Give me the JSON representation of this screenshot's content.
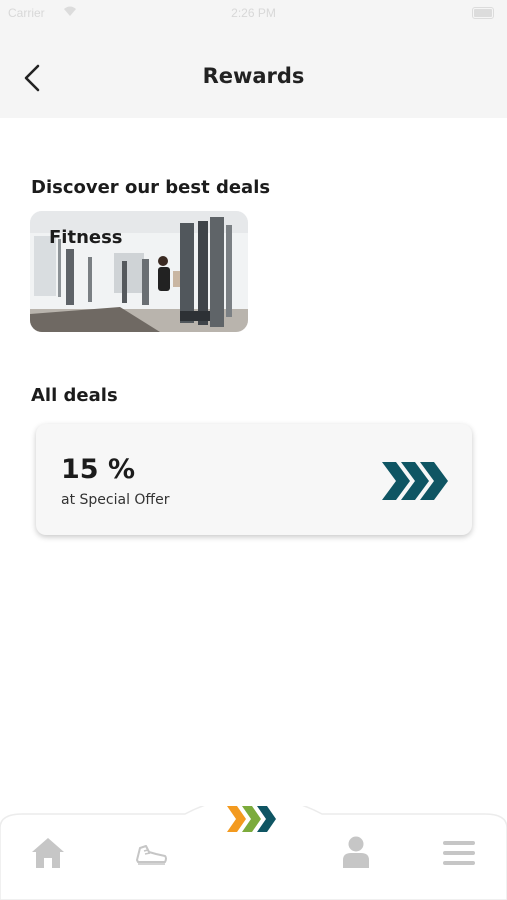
{
  "status_bar": {
    "carrier": "Carrier",
    "time": "2:26 PM"
  },
  "header": {
    "title": "Rewards",
    "back_icon": "chevron-left-icon"
  },
  "discover": {
    "title": "Discover our best deals",
    "tiles": [
      {
        "label": "Fitness",
        "image": "gym-photo"
      }
    ]
  },
  "all_deals": {
    "title": "All deals",
    "offers": [
      {
        "value": "15 %",
        "description": "at Special Offer",
        "icon": "triple-chevron-icon"
      }
    ]
  },
  "tab_bar": {
    "items": [
      {
        "name": "home",
        "icon": "home-icon"
      },
      {
        "name": "activity",
        "icon": "sneaker-icon"
      },
      {
        "name": "rewards",
        "icon": "brand-chevrons-icon"
      },
      {
        "name": "profile",
        "icon": "person-icon"
      },
      {
        "name": "menu",
        "icon": "hamburger-icon"
      }
    ]
  },
  "colors": {
    "accent_teal": "#0f5563",
    "accent_orange": "#f39a1f",
    "accent_green": "#7cab3c",
    "icon_gray": "#c6c6c6",
    "header_bg": "#f5f5f5"
  }
}
